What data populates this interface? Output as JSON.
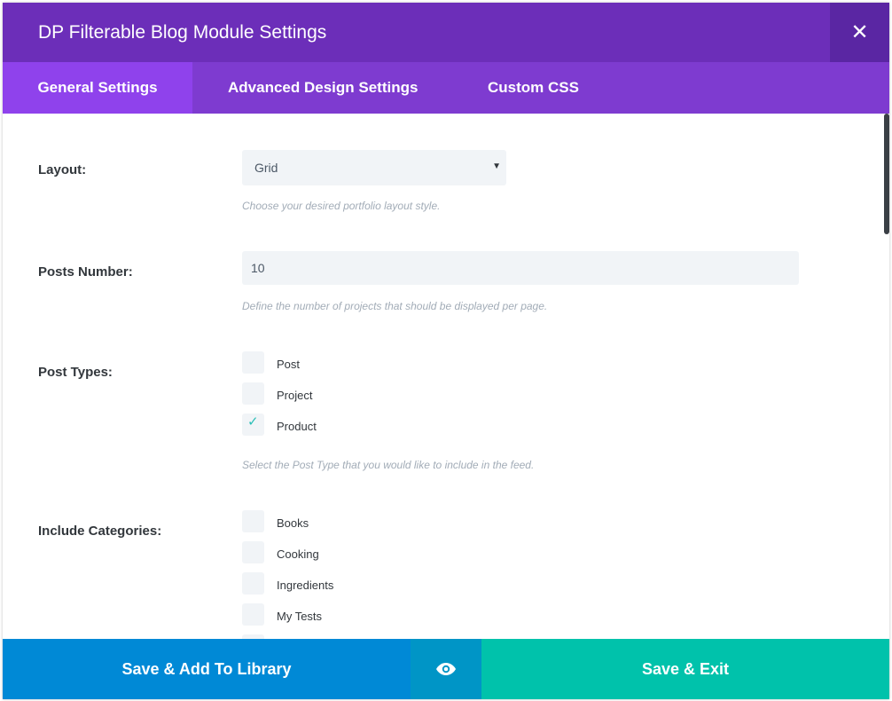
{
  "modal": {
    "title": "DP Filterable Blog Module Settings"
  },
  "tabs": [
    {
      "label": "General Settings",
      "active": true
    },
    {
      "label": "Advanced Design Settings",
      "active": false
    },
    {
      "label": "Custom CSS",
      "active": false
    }
  ],
  "fields": {
    "layout": {
      "label": "Layout:",
      "value": "Grid",
      "help": "Choose your desired portfolio layout style."
    },
    "posts_number": {
      "label": "Posts Number:",
      "value": "10",
      "help": "Define the number of projects that should be displayed per page."
    },
    "post_types": {
      "label": "Post Types:",
      "options": [
        {
          "label": "Post",
          "checked": false
        },
        {
          "label": "Project",
          "checked": false
        },
        {
          "label": "Product",
          "checked": true
        }
      ],
      "help": "Select the Post Type that you would like to include in the feed."
    },
    "include_categories": {
      "label": "Include Categories:",
      "options": [
        {
          "label": "Books",
          "checked": false
        },
        {
          "label": "Cooking",
          "checked": false
        },
        {
          "label": "Ingredients",
          "checked": false
        },
        {
          "label": "My Tests",
          "checked": false
        }
      ]
    }
  },
  "footer": {
    "save_library": "Save & Add To Library",
    "save_exit": "Save & Exit"
  },
  "icons": {
    "close": "close-icon",
    "preview": "eye-icon",
    "check": "checkmark-icon",
    "dropdown": "caret-down-icon"
  },
  "colors": {
    "titlebar": "#6c2eb9",
    "tabs": "#7e3bd0",
    "active_tab": "#8f42ec",
    "library_button": "#0089d6",
    "preview_button": "#0095c6",
    "exit_button": "#00c2ab",
    "check": "#2cbfb7"
  }
}
